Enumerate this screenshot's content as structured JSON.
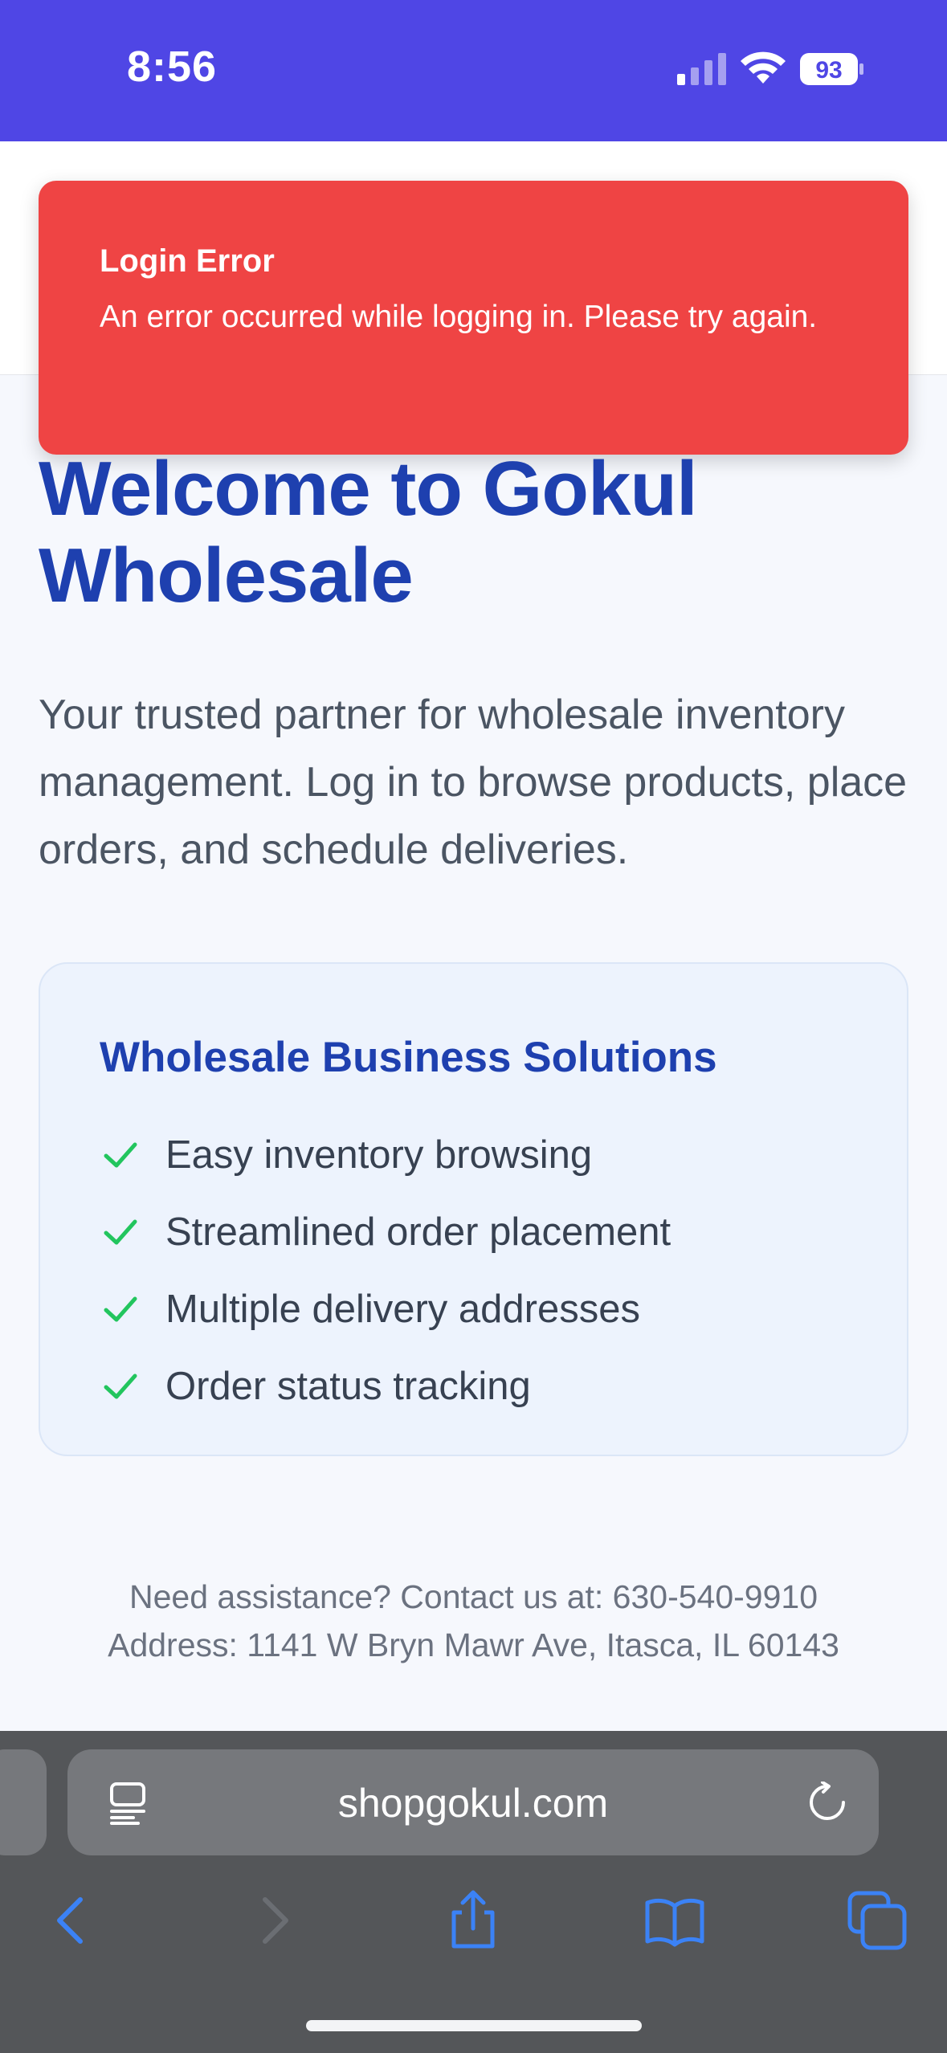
{
  "status_bar": {
    "time": "8:56",
    "battery": "93"
  },
  "toast": {
    "title": "Login Error",
    "message": "An error occurred while logging in. Please try again.",
    "color": "#ef4444"
  },
  "hero": {
    "title": "Welcome to Gokul Wholesale",
    "subtitle": "Your trusted partner for wholesale inventory management. Log in to browse products, place orders, and schedule deliveries."
  },
  "solutions": {
    "title": "Wholesale Business Solutions",
    "items": [
      {
        "label": "Easy inventory browsing",
        "icon": "check-icon"
      },
      {
        "label": "Streamlined order placement",
        "icon": "check-icon"
      },
      {
        "label": "Multiple delivery addresses",
        "icon": "check-icon"
      },
      {
        "label": "Order status tracking",
        "icon": "check-icon"
      }
    ]
  },
  "footer": {
    "contact": "Need assistance? Contact us at: 630-540-9910",
    "address": "Address: 1141 W Bryn Mawr Ave, Itasca, IL 60143"
  },
  "browser": {
    "url": "shopgokul.com",
    "icons": [
      "reader-icon",
      "reload-icon",
      "back-icon",
      "forward-icon",
      "share-icon",
      "bookmarks-icon",
      "tabs-icon"
    ]
  },
  "colors": {
    "status_bar": "#4f46e5",
    "brand_blue": "#1e40af",
    "check_green": "#22c55e",
    "browser_bg": "#545659",
    "nav_icon": "#3b82f6"
  }
}
